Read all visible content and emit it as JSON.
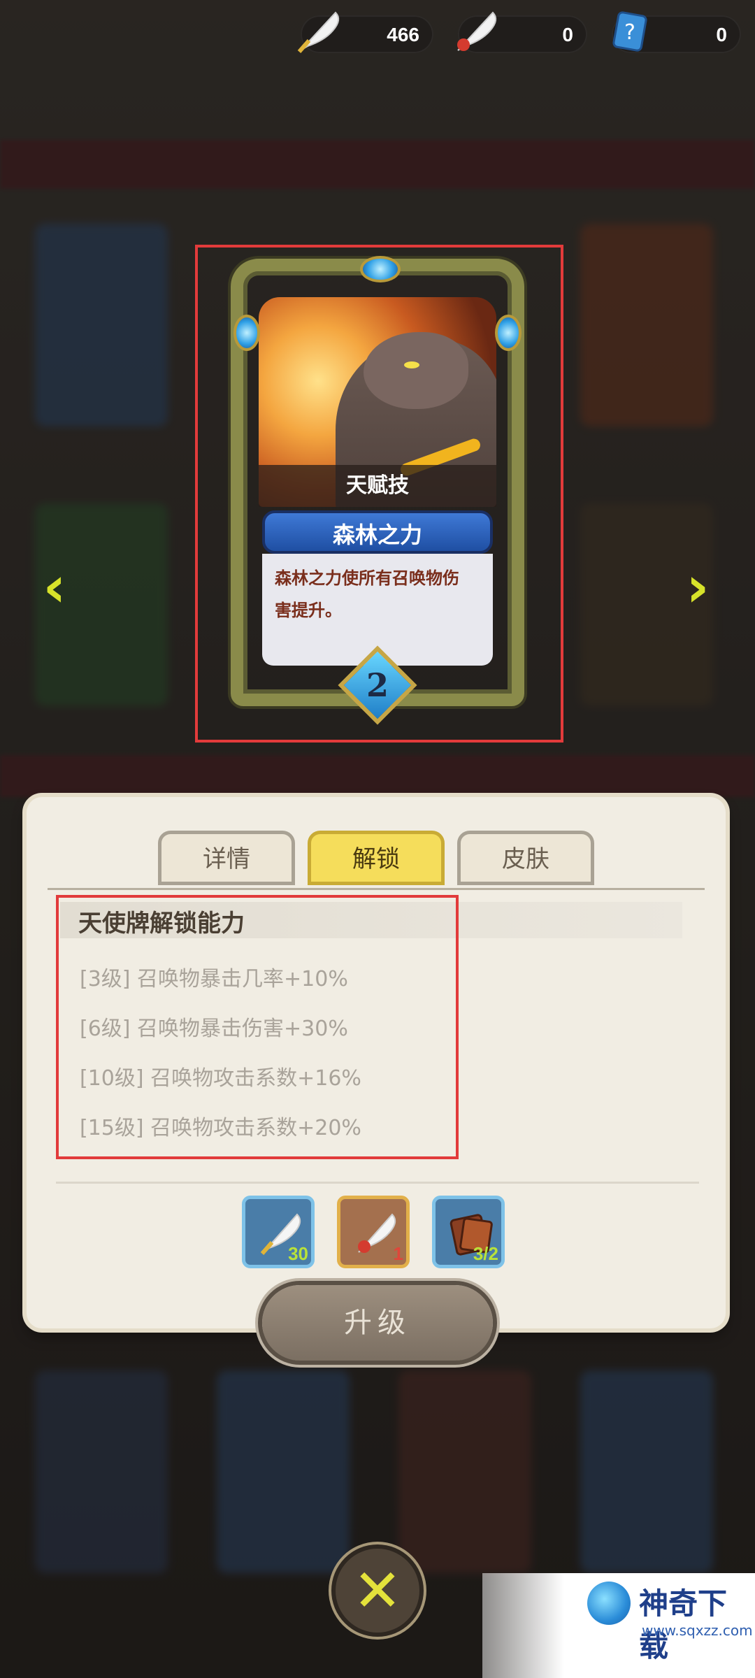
{
  "currencies": [
    {
      "name": "feather-gold",
      "amount": "466"
    },
    {
      "name": "feather-red",
      "amount": "0"
    },
    {
      "name": "mystery-card",
      "amount": "0"
    }
  ],
  "card": {
    "talent_label": "天赋技",
    "skill_name": "森林之力",
    "skill_desc_line1": "森林之力使所有召唤物伤",
    "skill_desc_line2": "害提升。",
    "level": "2"
  },
  "nav": {
    "prev": "‹",
    "next": "›"
  },
  "tabs": [
    {
      "label": "详情",
      "active": false
    },
    {
      "label": "解锁",
      "active": true
    },
    {
      "label": "皮肤",
      "active": false
    }
  ],
  "unlock": {
    "title": "天使牌解锁能力",
    "abilities": [
      "[3级]  召唤物暴击几率+10%",
      "[6级]  召唤物暴击伤害+30%",
      "[10级]  召唤物攻击系数+16%",
      "[15级]  召唤物攻击系数+20%"
    ]
  },
  "materials": [
    {
      "name": "feather-gold",
      "qty": "30",
      "qty_color": "#b9e23a"
    },
    {
      "name": "feather-red",
      "qty": "1",
      "qty_color": "#e0463a"
    },
    {
      "name": "card-book",
      "qty": "3/2",
      "qty_color": "#b9e23a"
    }
  ],
  "upgrade_label": "升级",
  "close_label": "✕",
  "watermark": {
    "text": "神奇下载",
    "url": "www.sqxzz.com"
  }
}
